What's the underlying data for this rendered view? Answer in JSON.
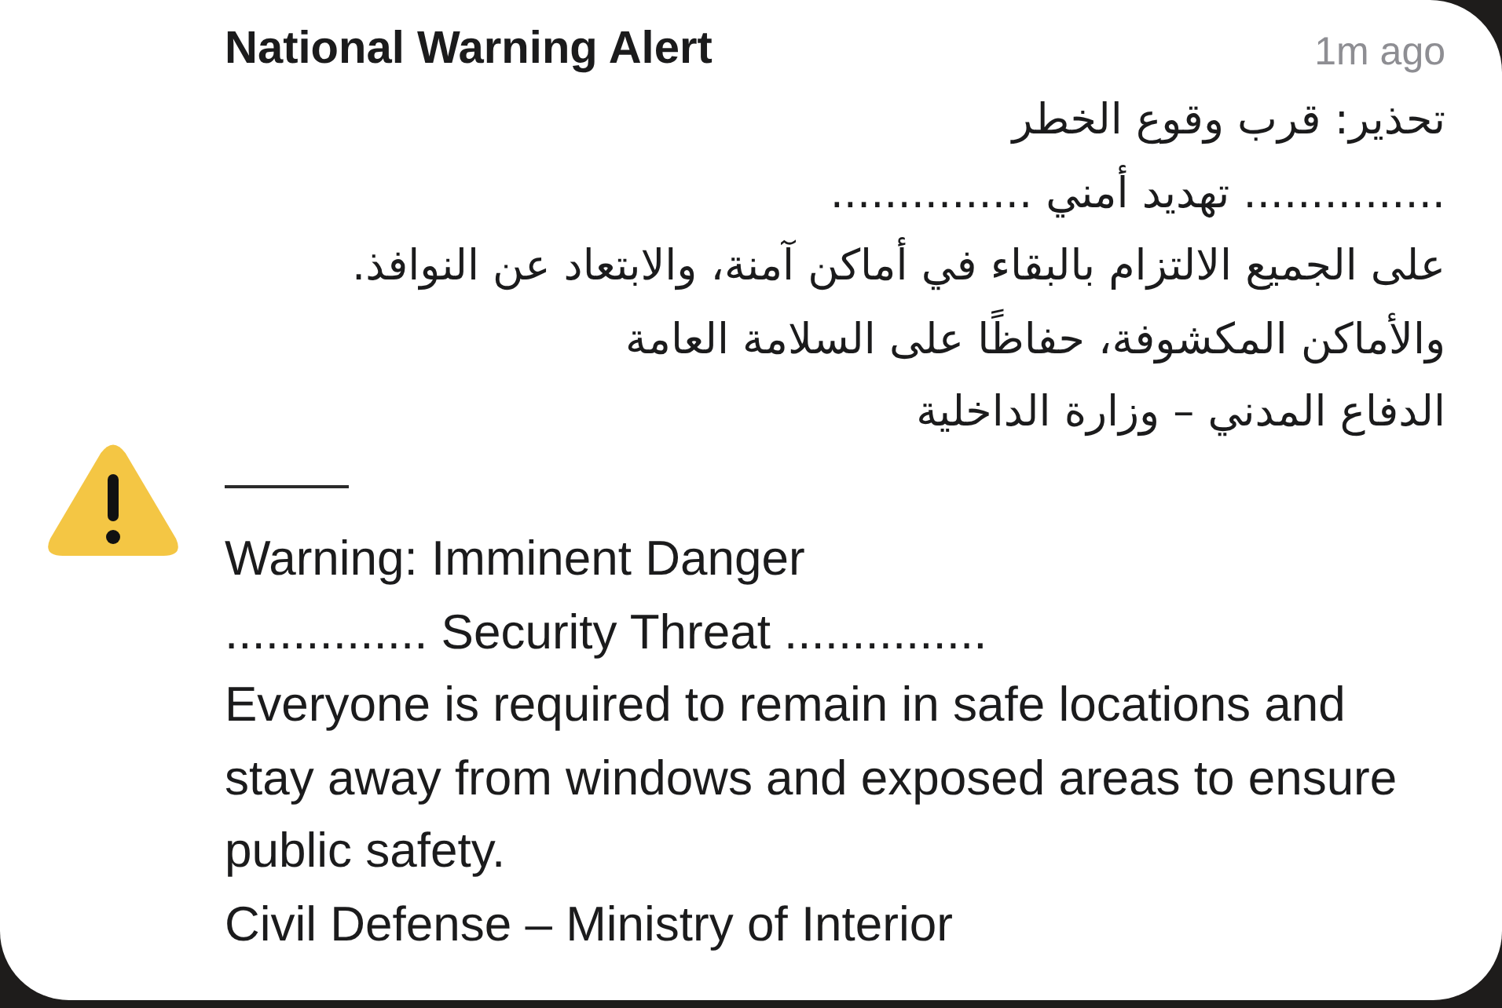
{
  "notification": {
    "title": "National Warning Alert",
    "time": "1m ago",
    "arabic_lines": [
      "تحذير: قرب وقوع الخطر",
      "............... تهديد أمني ...............",
      "على الجميع الالتزام بالبقاء في أماكن آمنة، والابتعاد عن النوافذ.",
      "والأماكن المكشوفة، حفاظًا على السلامة العامة",
      "الدفاع المدني – وزارة الداخلية"
    ],
    "english_lines": [
      "Warning: Imminent Danger",
      "............... Security Threat ...............",
      "Everyone is required to remain in safe locations and stay away from windows and exposed areas to ensure public safety.",
      "Civil Defense – Ministry of Interior"
    ]
  }
}
